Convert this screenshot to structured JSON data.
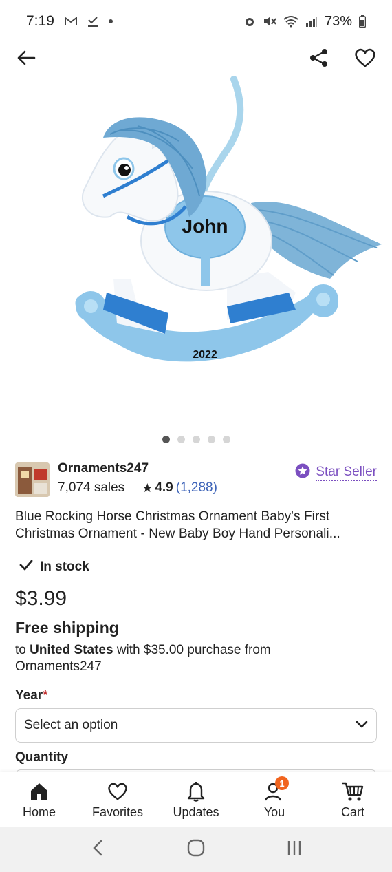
{
  "status_bar": {
    "time": "7:19",
    "battery": "73%",
    "icons": [
      "gmail-icon",
      "download-done-icon",
      "dot-icon",
      "alarm-icon",
      "mute-icon",
      "wifi-icon",
      "signal-icon",
      "battery-icon"
    ]
  },
  "top_nav": {
    "back_icon": "arrow-left-icon",
    "share_icon": "share-icon",
    "favorite_icon": "heart-outline-icon"
  },
  "product_image": {
    "name_text": "John",
    "year_text": "2022",
    "colors": {
      "light_blue": "#8ec6ea",
      "blue": "#2f7fd0",
      "white": "#f7f9fb"
    }
  },
  "carousel": {
    "count": 5,
    "active_index": 0
  },
  "shop": {
    "name": "Ornaments247",
    "sales": "7,074 sales",
    "rating": "4.9",
    "reviews": "(1,288)",
    "badge_label": "Star Seller",
    "badge_color": "#7b4fc0"
  },
  "listing": {
    "title_line1": "Blue Rocking Horse Christmas Ornament  Baby's First",
    "title_line2": "Christmas Ornament - New Baby Boy Hand Personali...",
    "stock": "In stock",
    "price": "$3.99",
    "shipping_title": "Free shipping",
    "shipping_to": "to ",
    "shipping_country": "United States",
    "shipping_rest": " with $35.00 purchase from",
    "shipping_shop": "Ornaments247"
  },
  "options": {
    "year_label": "Year",
    "required_mark": "*",
    "year_placeholder": "Select an option",
    "quantity_label": "Quantity"
  },
  "bottom_nav": {
    "items": [
      {
        "label": "Home",
        "icon": "home-icon"
      },
      {
        "label": "Favorites",
        "icon": "heart-icon"
      },
      {
        "label": "Updates",
        "icon": "bell-icon"
      },
      {
        "label": "You",
        "icon": "person-icon",
        "badge": "1"
      },
      {
        "label": "Cart",
        "icon": "cart-icon"
      }
    ]
  },
  "system_nav": {
    "icons": [
      "back-chevron-icon",
      "home-circle-icon",
      "recents-icon"
    ]
  }
}
